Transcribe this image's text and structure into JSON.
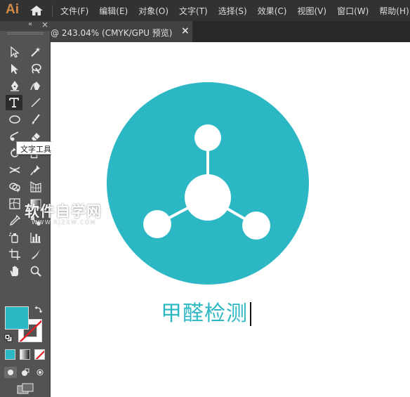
{
  "app": {
    "logo": "Ai"
  },
  "menu": {
    "items": [
      "文件(F)",
      "编辑(E)",
      "对象(O)",
      "文字(T)",
      "选择(S)",
      "效果(C)",
      "视图(V)",
      "窗口(W)",
      "帮助(H)"
    ]
  },
  "document_tab": {
    "title": "@ 243.04% (CMYK/GPU 预览)",
    "close_label": "×"
  },
  "toolbar": {
    "collapse_label": "«",
    "close_label": "×",
    "active_tool": "type-tool",
    "tooltip": "文字工具 (T)",
    "more_label": "•••",
    "fill_color": "#2bb7c4",
    "stroke_color": "none"
  },
  "canvas": {
    "text": "甲醛检测",
    "accent_color": "#2bb7c4",
    "icon": "molecule-icon"
  },
  "watermark": {
    "title": "软件自学网",
    "url": "WWW.RJZXW.COM"
  }
}
